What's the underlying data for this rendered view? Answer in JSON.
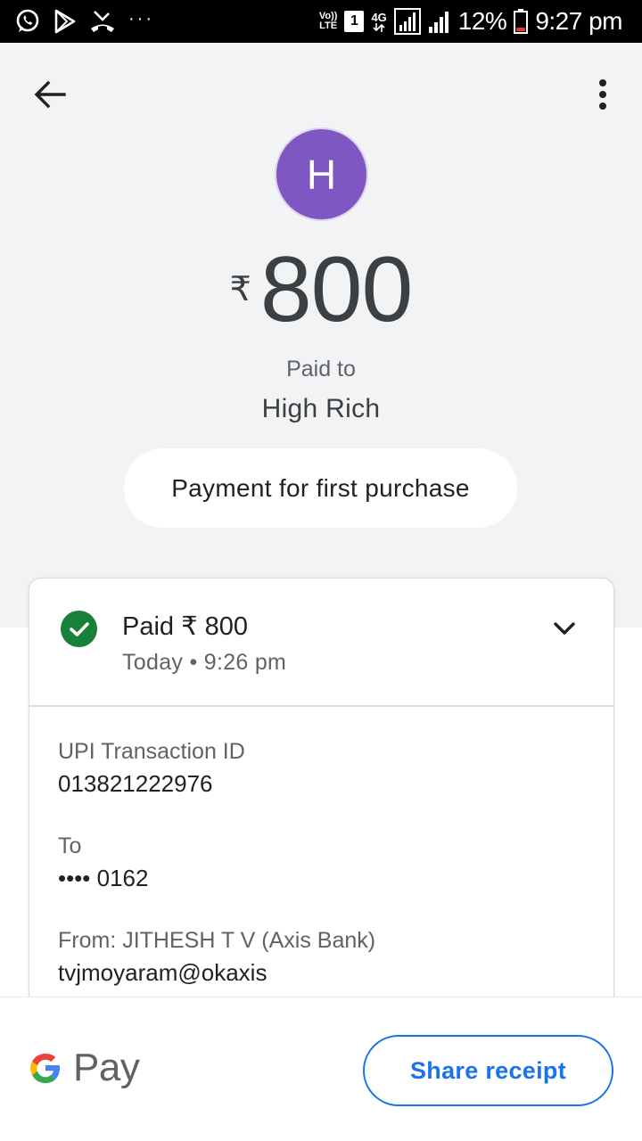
{
  "status_bar": {
    "icons": [
      "whatsapp-icon",
      "play-store-icon",
      "missed-call-icon",
      "more-notifications-icon",
      "volte-icon",
      "sim-icon",
      "4g-icon",
      "signal-icon",
      "signal-icon-2",
      "battery-icon"
    ],
    "dots": "···",
    "volte_top": "Vo))",
    "volte_bottom": "LTE",
    "sim_number": "1",
    "network": "4G",
    "battery": "12%",
    "time": "9:27 pm"
  },
  "header": {
    "back_icon": "back-arrow-icon",
    "more_icon": "more-vert-icon"
  },
  "payment": {
    "avatar_initial": "H",
    "avatar_color": "#7e57c2",
    "currency_symbol": "₹",
    "amount": "800",
    "paid_to_label": "Paid to",
    "payee_name": "High Rich",
    "note": "Payment for first purchase"
  },
  "details": {
    "status_icon": "check-circle-icon",
    "status_color": "#188038",
    "status_title": "Paid ₹ 800",
    "date": "Today • 9:26 pm",
    "expand_icon": "chevron-down-icon",
    "upi_label": "UPI Transaction ID",
    "upi_value": "013821222976",
    "to_label": "To",
    "to_value": "•••• 0162",
    "from_label": "From: JITHESH T V (Axis Bank)",
    "from_value": "tvjmoyaram@okaxis"
  },
  "footer": {
    "logo_icon": "google-g-icon",
    "logo_text": "Pay",
    "share_label": "Share receipt",
    "accent_color": "#1a73e8"
  }
}
